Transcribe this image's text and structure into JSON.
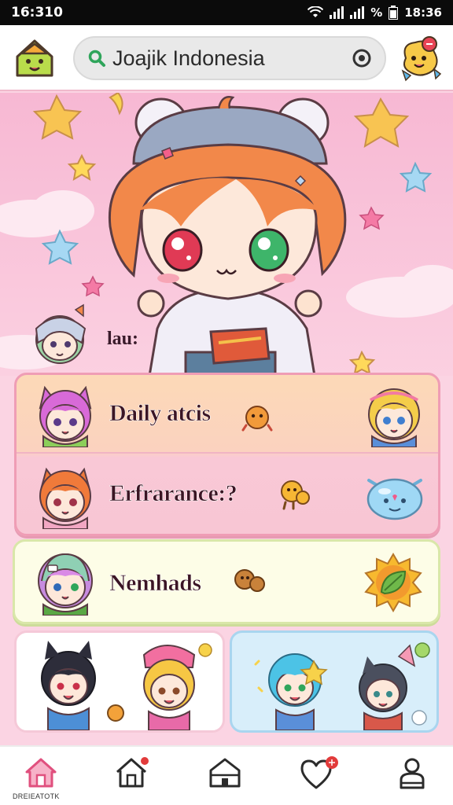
{
  "status_bar": {
    "time": "16:310",
    "battery_text": "%",
    "clock_right": "18:36"
  },
  "search": {
    "value": "Joajik Indonesia"
  },
  "hero": {
    "label": "lau:"
  },
  "menu": {
    "items": [
      {
        "label": "Daily atcis"
      },
      {
        "label": "Erfrarance:?"
      },
      {
        "label": "Nemhads"
      }
    ]
  },
  "nav": {
    "home_label": "DREIEATOTK"
  },
  "colors": {
    "background": "#fbd4e3",
    "accent": "#e85a8a",
    "badge": "#e23b3b"
  }
}
